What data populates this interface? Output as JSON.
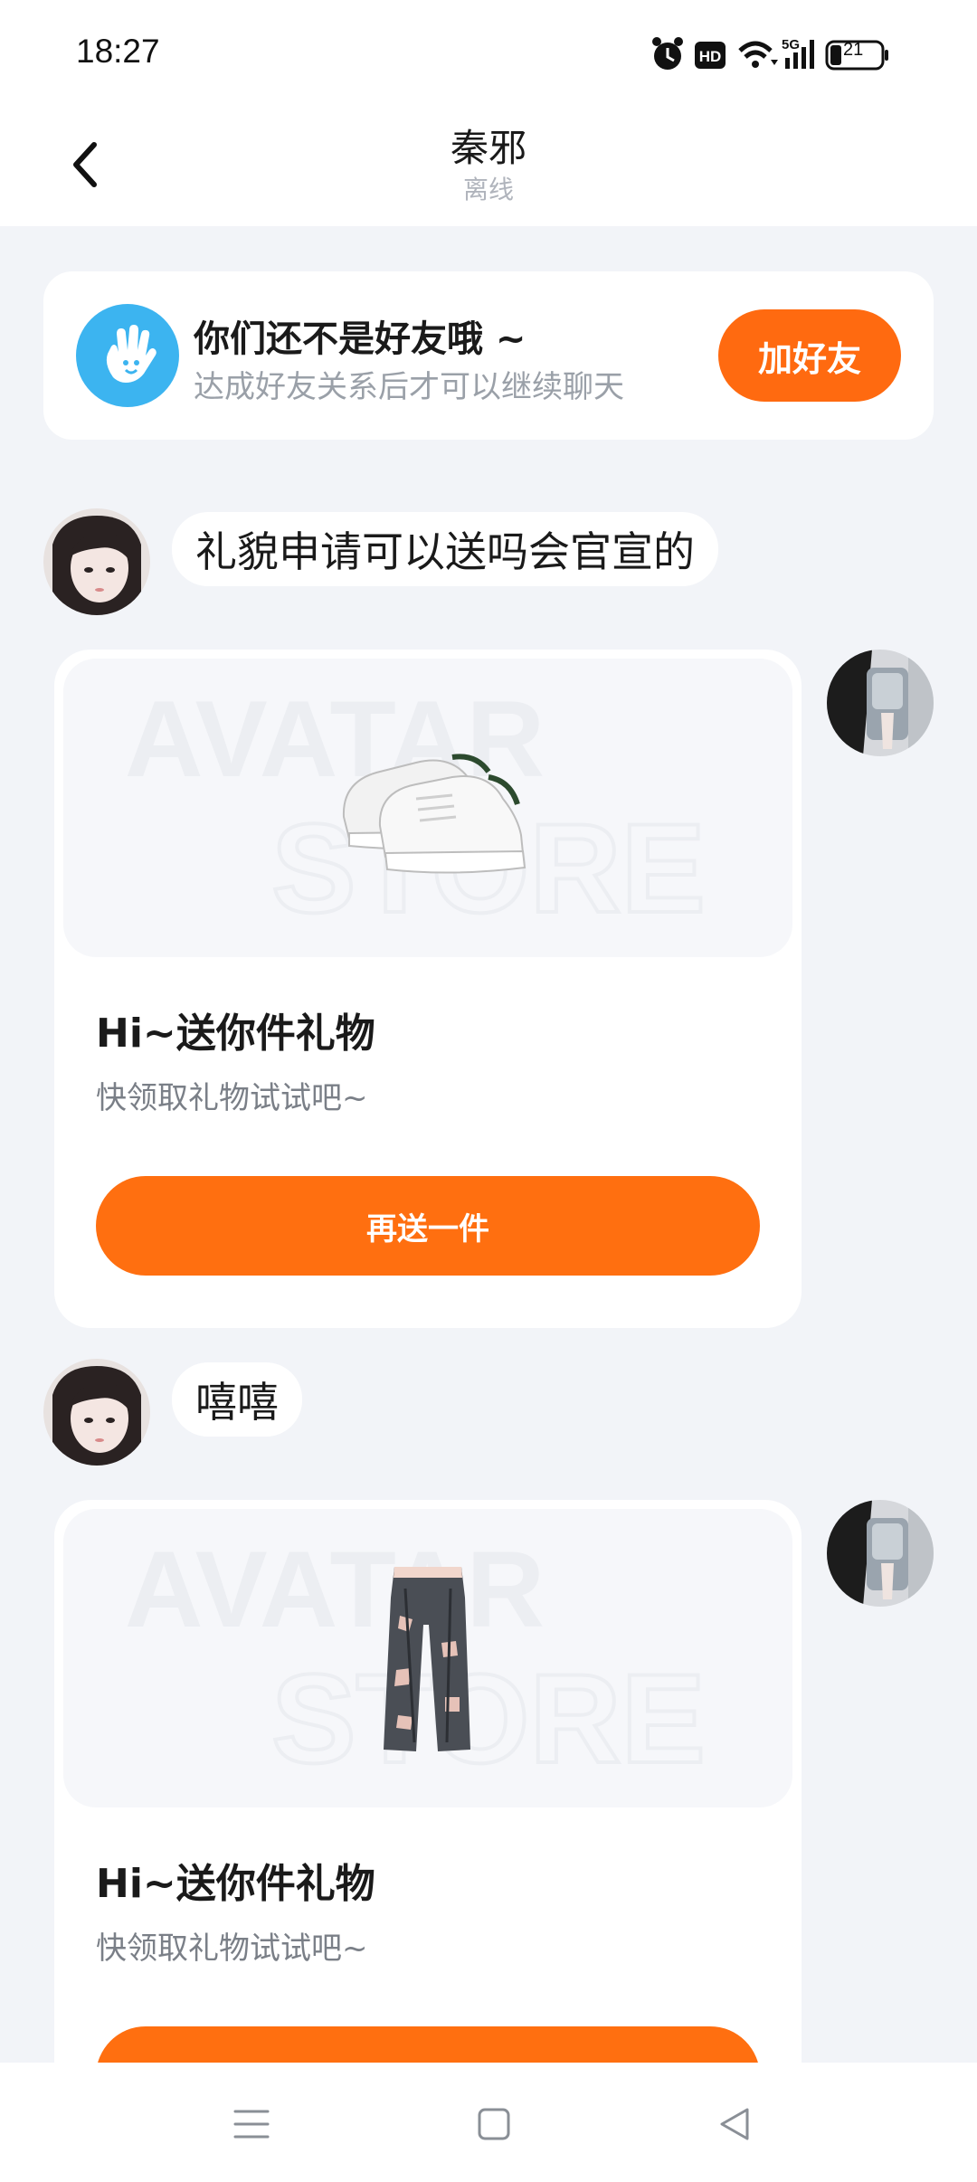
{
  "status_bar": {
    "time": "18:27",
    "icons": [
      "alarm-icon",
      "hd-icon",
      "wifi-icon",
      "5g-signal-icon",
      "battery-icon"
    ],
    "battery_level": "21"
  },
  "header": {
    "back_icon": "chevron-left-icon",
    "title": "秦邪",
    "status": "离线"
  },
  "friend_banner": {
    "icon": "hand-wave-icon",
    "title": "你们还不是好友哦 ~",
    "subtitle": "达成好友关系后才可以继续聊天",
    "button_label": "加好友"
  },
  "messages": [
    {
      "type": "text",
      "side": "left",
      "text": "礼貌申请可以送吗会官宣的"
    },
    {
      "type": "gift",
      "side": "right",
      "watermark_line1": "AVATAR",
      "watermark_line2": "STORE",
      "image": "white-sneakers",
      "title": "Hi~送你件礼物",
      "subtitle": "快领取礼物试试吧~",
      "button_label": "再送一件"
    },
    {
      "type": "text",
      "side": "left",
      "text": "嘻嘻"
    },
    {
      "type": "gift",
      "side": "right",
      "watermark_line1": "AVATAR",
      "watermark_line2": "STORE",
      "image": "ripped-jeans",
      "title": "Hi~送你件礼物",
      "subtitle": "快领取礼物试试吧~",
      "button_label": ""
    }
  ],
  "nav_bar": {
    "icons": [
      "menu-icon",
      "home-square-icon",
      "back-triangle-icon"
    ]
  },
  "colors": {
    "accent": "#ff6a10",
    "background": "#f2f4f8",
    "banner_icon_bg": "#3cb4f0"
  }
}
